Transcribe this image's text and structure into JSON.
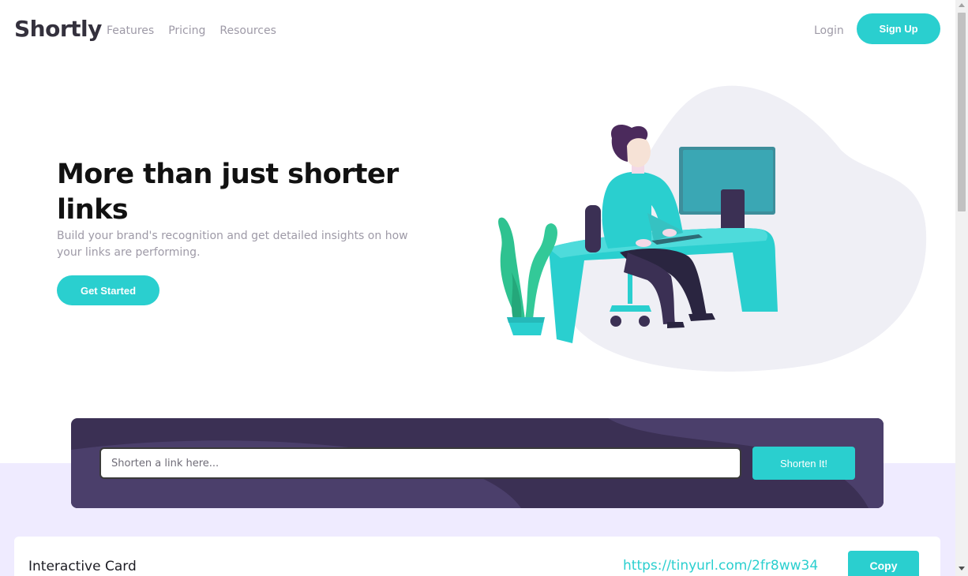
{
  "header": {
    "logo": "Shortly",
    "nav": [
      {
        "label": "Features"
      },
      {
        "label": "Pricing"
      },
      {
        "label": "Resources"
      }
    ],
    "login_label": "Login",
    "signup_label": "Sign Up"
  },
  "hero": {
    "title": "More than just shorter links",
    "subtitle": "Build your brand's recognition and get detailed insights on how your links are performing.",
    "cta_label": "Get Started",
    "illustration_icon": "person-working-illustration"
  },
  "shorten": {
    "placeholder": "Shorten a link here...",
    "value": "",
    "button_label": "Shorten It!"
  },
  "result": {
    "label": "Interactive Card",
    "short_link": "https://tinyurl.com/2fr8ww34",
    "copy_label": "Copy"
  },
  "colors": {
    "accent": "#2acfcf",
    "dark_violet": "#3b3054",
    "band": "#efebff",
    "text_gray": "#9e9aa7"
  }
}
